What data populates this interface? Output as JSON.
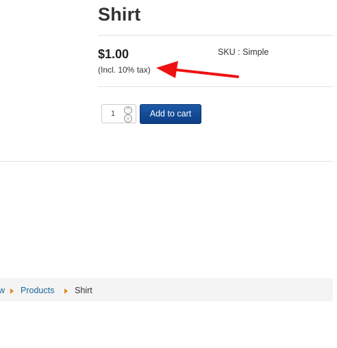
{
  "product": {
    "title": "Shirt",
    "price": "$1.00",
    "tax_note": "(Incl. 10% tax)",
    "sku": "SKU : Simple"
  },
  "cart": {
    "quantity": "1",
    "spin_up": "⌃",
    "spin_down": "⌄",
    "add_label": "Add to cart"
  },
  "breadcrumb": {
    "items": [
      {
        "label": "w"
      },
      {
        "label": "Products"
      },
      {
        "label": "Shirt"
      }
    ]
  },
  "colors": {
    "accent": "#0c3d85",
    "link": "#1a6495",
    "separator": "#e08a1e",
    "annotation_arrow": "#ee1111"
  },
  "icons": {
    "annotation": "arrow-pointing-left"
  }
}
